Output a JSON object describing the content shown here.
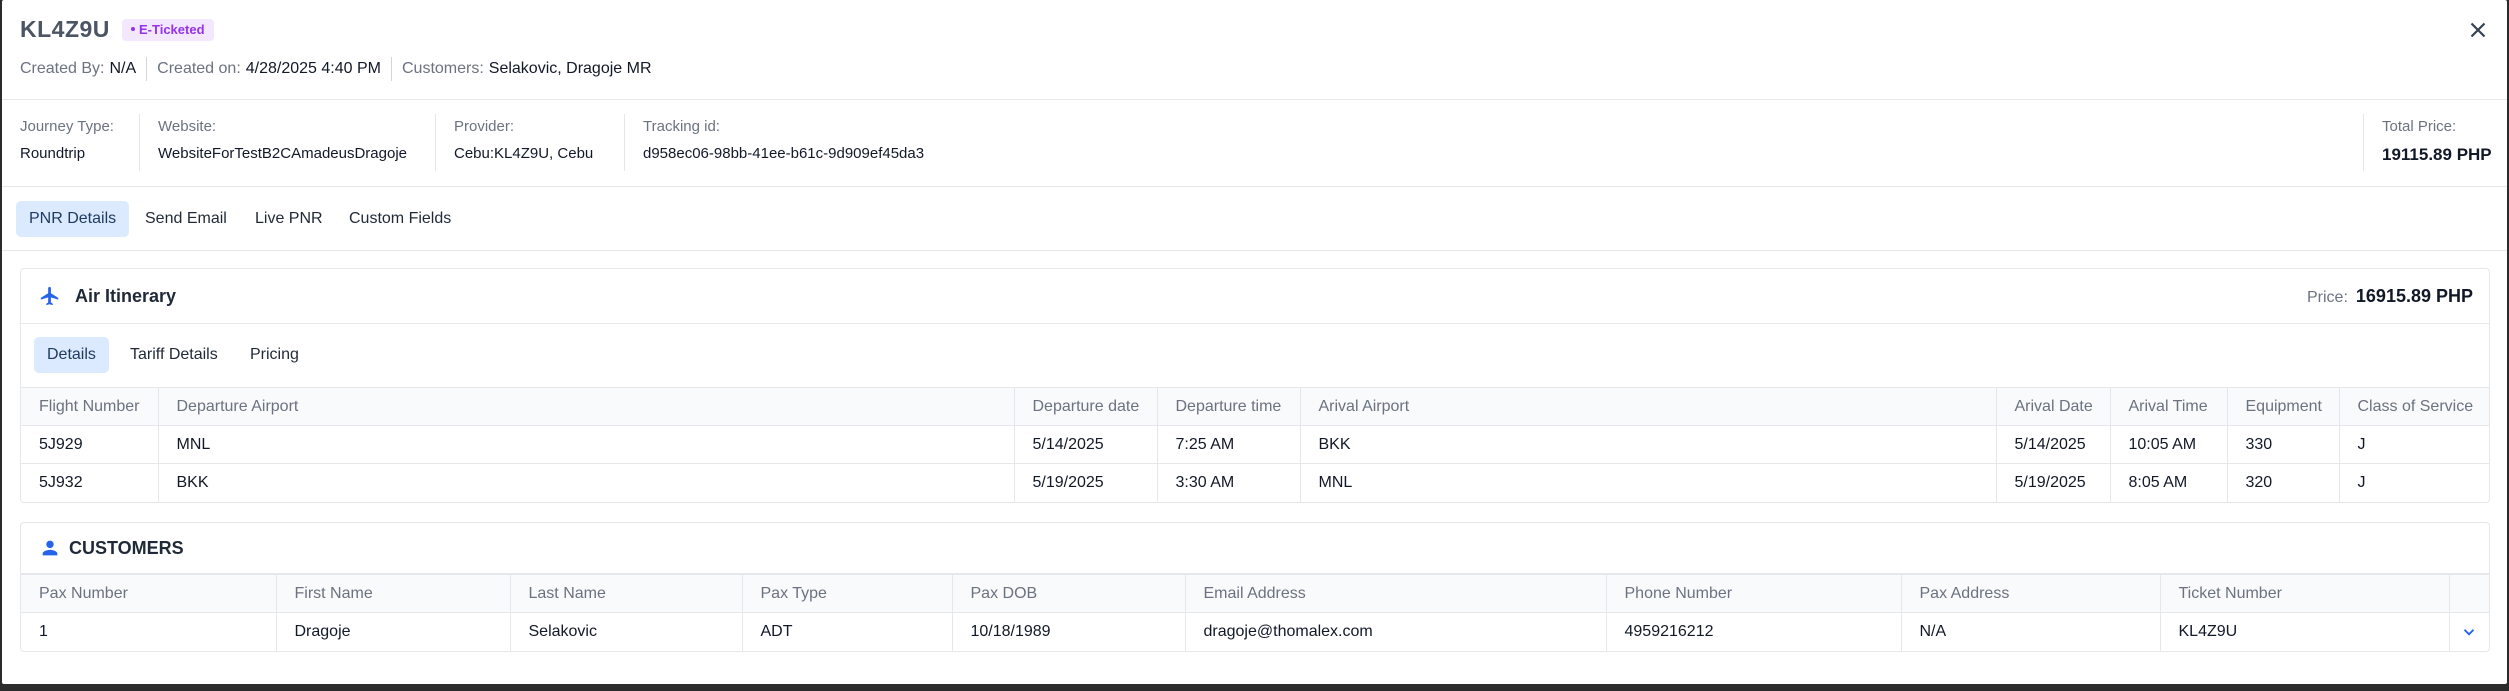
{
  "header": {
    "pnr_code": "KL4Z9U",
    "status": "E-Ticketed",
    "created_by_label": "Created By:",
    "created_by_value": "N/A",
    "created_on_label": "Created on:",
    "created_on_value": "4/28/2025 4:40 PM",
    "customers_label": "Customers:",
    "customers_value": "Selakovic, Dragoje MR"
  },
  "info": {
    "journey_type_label": "Journey Type:",
    "journey_type_value": "Roundtrip",
    "website_label": "Website:",
    "website_value": "WebsiteForTestB2CAmadeusDragoje",
    "provider_label": "Provider:",
    "provider_value": "Cebu:KL4Z9U, Cebu",
    "tracking_label": "Tracking id:",
    "tracking_value": "d958ec06-98bb-41ee-b61c-9d909ef45da3",
    "total_price_label": "Total Price:",
    "total_price_value": "19115.89 PHP"
  },
  "tabs": [
    "PNR Details",
    "Send Email",
    "Live PNR",
    "Custom Fields"
  ],
  "air_itinerary": {
    "title": "Air Itinerary",
    "price_label": "Price:",
    "price_value": "16915.89 PHP",
    "subtabs": [
      "Details",
      "Tariff Details",
      "Pricing"
    ],
    "columns": [
      "Flight Number",
      "Departure Airport",
      "Departure date",
      "Departure time",
      "Arival Airport",
      "Arival Date",
      "Arival Time",
      "Equipment",
      "Class of Service"
    ],
    "rows": [
      [
        "5J929",
        "MNL",
        "5/14/2025",
        "7:25 AM",
        "BKK",
        "5/14/2025",
        "10:05 AM",
        "330",
        "J"
      ],
      [
        "5J932",
        "BKK",
        "5/19/2025",
        "3:30 AM",
        "MNL",
        "5/19/2025",
        "8:05 AM",
        "320",
        "J"
      ]
    ]
  },
  "customers": {
    "title": "CUSTOMERS",
    "columns": [
      "Pax Number",
      "First Name",
      "Last Name",
      "Pax Type",
      "Pax DOB",
      "Email Address",
      "Phone Number",
      "Pax Address",
      "Ticket Number"
    ],
    "rows": [
      [
        "1",
        "Dragoje",
        "Selakovic",
        "ADT",
        "10/18/1989",
        "dragoje@thomalex.com",
        "4959216212",
        "N/A",
        "KL4Z9U"
      ]
    ]
  },
  "colors": {
    "accent": "#2563eb",
    "badge_bg": "#f3e8ff",
    "badge_text": "#9333ea",
    "tab_active_bg": "#dbeafe"
  },
  "icons": {
    "close": "close-icon",
    "plane": "plane-icon",
    "user": "user-icon",
    "expand": "chevron-down-icon"
  }
}
